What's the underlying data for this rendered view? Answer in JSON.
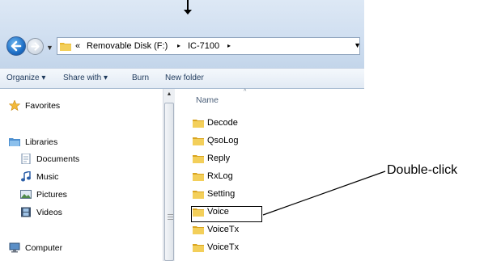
{
  "address": {
    "crumbs": [
      "«",
      "Removable Disk (F:)",
      "▸",
      "IC-7100",
      "▸"
    ]
  },
  "toolbar": {
    "organize": "Organize ▾",
    "share_with": "Share with ▾",
    "burn": "Burn",
    "new_folder": "New folder"
  },
  "nav": {
    "favorites": "Favorites",
    "libraries": "Libraries",
    "documents": "Documents",
    "music": "Music",
    "pictures": "Pictures",
    "videos": "Videos",
    "computer": "Computer"
  },
  "file_list": {
    "column_name": "Name",
    "items": [
      "Decode",
      "QsoLog",
      "Reply",
      "RxLog",
      "Setting",
      "Voice",
      "VoiceTx",
      "VoiceTx"
    ]
  },
  "annotation": {
    "callout": "Double-click"
  },
  "icons": {
    "back": "back-arrow-icon",
    "forward": "forward-arrow-icon",
    "folder": "folder-icon",
    "favorites": "star-icon",
    "libraries": "library-icon",
    "documents": "document-icon",
    "music": "music-note-icon",
    "pictures": "picture-icon",
    "videos": "film-icon",
    "computer": "computer-icon"
  },
  "colors": {
    "folder": "#e8b830",
    "address_gradient": "#cfdef0",
    "toolbar_text": "#1e395b",
    "back_button": "#1e6fc6"
  }
}
